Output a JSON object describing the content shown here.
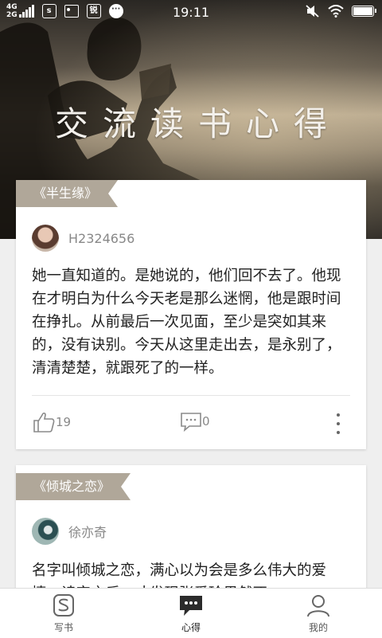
{
  "status_bar": {
    "network_top": "4G",
    "network_bottom": "2G",
    "app_icon_1": "s",
    "app_icon_2": "锐",
    "time": "19:11"
  },
  "hero": {
    "title": "交流读书心得"
  },
  "posts": [
    {
      "book_tag": "《半生缘》",
      "author": "H2324656",
      "content": "她一直知道的。是她说的，他们回不去了。他现在才明白为什么今天老是那么迷惘，他是跟时间在挣扎。从前最后一次见面，至少是突如其来的，没有诀别。今天从这里走出去，是永别了，清清楚楚，就跟死了的一样。",
      "likes": "19",
      "comments": "0"
    },
    {
      "book_tag": "《倾城之恋》",
      "author": "徐亦奇",
      "content": "名字叫倾城之恋，满心以为会是多么伟大的爱情，读完之后，才发现张爱玲果然不"
    }
  ],
  "bottom_nav": [
    {
      "label": "写书",
      "icon": "write-book-icon",
      "active": false
    },
    {
      "label": "心得",
      "icon": "chat-bubble-icon",
      "active": true
    },
    {
      "label": "我的",
      "icon": "profile-icon",
      "active": false
    }
  ],
  "colors": {
    "ribbon": "#b0a799",
    "background": "#efefef"
  }
}
